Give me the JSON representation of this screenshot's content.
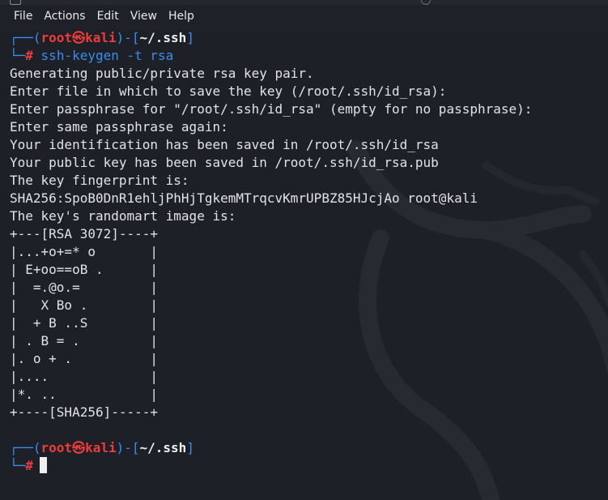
{
  "menu": [
    "File",
    "Actions",
    "Edit",
    "View",
    "Help"
  ],
  "prompt": {
    "open": "┌──(",
    "user": "root",
    "at": "㉿",
    "host": "kali",
    "mid": ")-[",
    "path": "~/.ssh",
    "close": "]",
    "corner": "└─",
    "symbol": "#"
  },
  "command": "ssh-keygen -t rsa",
  "output": [
    "Generating public/private rsa key pair.",
    "Enter file in which to save the key (/root/.ssh/id_rsa):",
    "Enter passphrase for \"/root/.ssh/id_rsa\" (empty for no passphrase):",
    "Enter same passphrase again:",
    "Your identification has been saved in /root/.ssh/id_rsa",
    "Your public key has been saved in /root/.ssh/id_rsa.pub",
    "The key fingerprint is:",
    "SHA256:SpoB0DnR1ehljPhHjTgkemMTrqcvKmrUPBZ85HJcjAo root@kali",
    "The key's randomart image is:",
    "+---[RSA 3072]----+",
    "|...+o+=* o       |",
    "| E+oo==oB .      |",
    "|  =.@o.=         |",
    "|   X Bo .        |",
    "|  + B ..S        |",
    "| . B = .         |",
    "|. o + .          |",
    "|....             |",
    "|*. ..            |",
    "+----[SHA256]-----+"
  ],
  "colors": {
    "background": "#1d2027",
    "text": "#e3e3e3",
    "prompt_blue": "#3c8cf0",
    "prompt_red": "#ee3b3b"
  }
}
